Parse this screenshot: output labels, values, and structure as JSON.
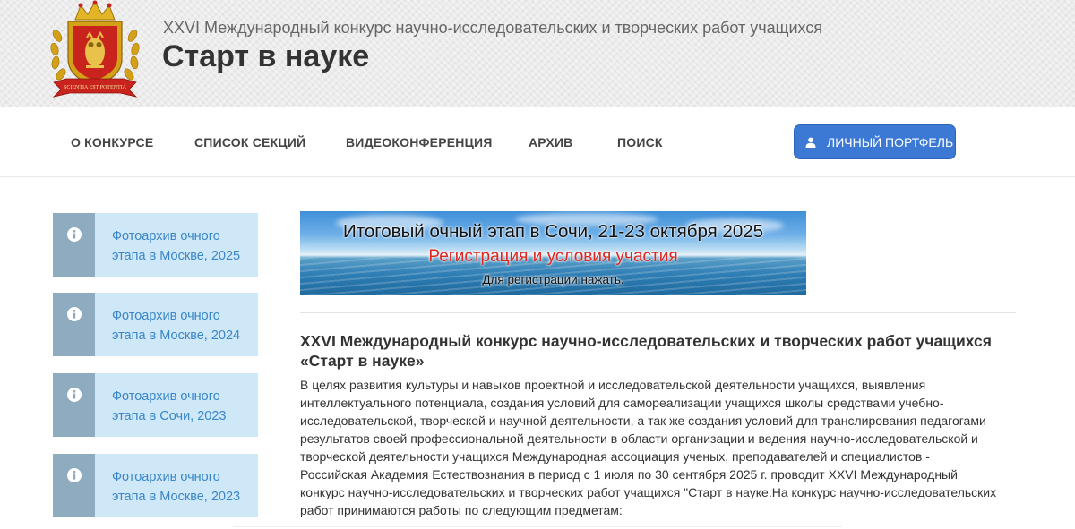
{
  "header": {
    "subtitle": "XXVI Международный конкурс научно-исследовательских и творческих работ учащихся",
    "title": "Старт в науке",
    "logo": {
      "ribbon_text": "SCIENTIA EST POTENTIA"
    }
  },
  "nav": {
    "items": [
      {
        "label": "О КОНКУРСЕ"
      },
      {
        "label": "СПИСОК СЕКЦИЙ"
      },
      {
        "label": "ВИДЕОКОНФЕРЕНЦИЯ"
      },
      {
        "label": "АРХИВ"
      },
      {
        "label": "ПОИСК"
      }
    ],
    "portfolio_button": {
      "label": "ЛИЧНЫЙ ПОРТФЕЛЬ",
      "icon": "user-icon"
    }
  },
  "sidebar": {
    "items": [
      {
        "label": "Фотоархив очного этапа в Москве, 2025",
        "icon": "info-icon"
      },
      {
        "label": "Фотоархив очного этапа в Москве, 2024",
        "icon": "info-icon"
      },
      {
        "label": "Фотоархив очного этапа в Сочи, 2023",
        "icon": "info-icon"
      },
      {
        "label": "Фотоархив очного этапа в Москве, 2023",
        "icon": "info-icon"
      }
    ]
  },
  "banner": {
    "line1": "Итоговый очный этап в Сочи, 21-23 октября 2025",
    "line2": "Регистрация и условия участия",
    "line3": "Для регистрации нажать."
  },
  "article": {
    "heading": "XXVI Международный конкурс научно-исследовательских и творческих работ учащихся «Старт в науке»",
    "body": "В целях развития культуры и навыков проектной и исследовательской деятельности учащихся, выявления интеллектуального потенциала, создания условий для самореализации учащихся школы средствами учебно-исследовательской, творческой и научной деятельности, а так же создания условий для транслирования педагогами результатов своей профессиональной деятельности в области организации и ведения научно-исследовательской и творческой деятельности учащихся Международная ассоциация ученых, преподавателей и специалистов - Российская Академия Естествознания в период с 1 июля по 30 сентября 2025 г. проводит XXVI Международный конкурс научно-исследовательских и творческих работ учащихся \"Старт в науке.На конкурс научно-исследовательских работ принимаются работы по следующим предметам:"
  },
  "colors": {
    "accent_button": "#3b79d4",
    "sidebar_card": "#cfe8f7",
    "sidebar_icon_bg": "#8eabbf",
    "sidebar_link": "#3a86c8",
    "banner_highlight": "#e0251e"
  }
}
